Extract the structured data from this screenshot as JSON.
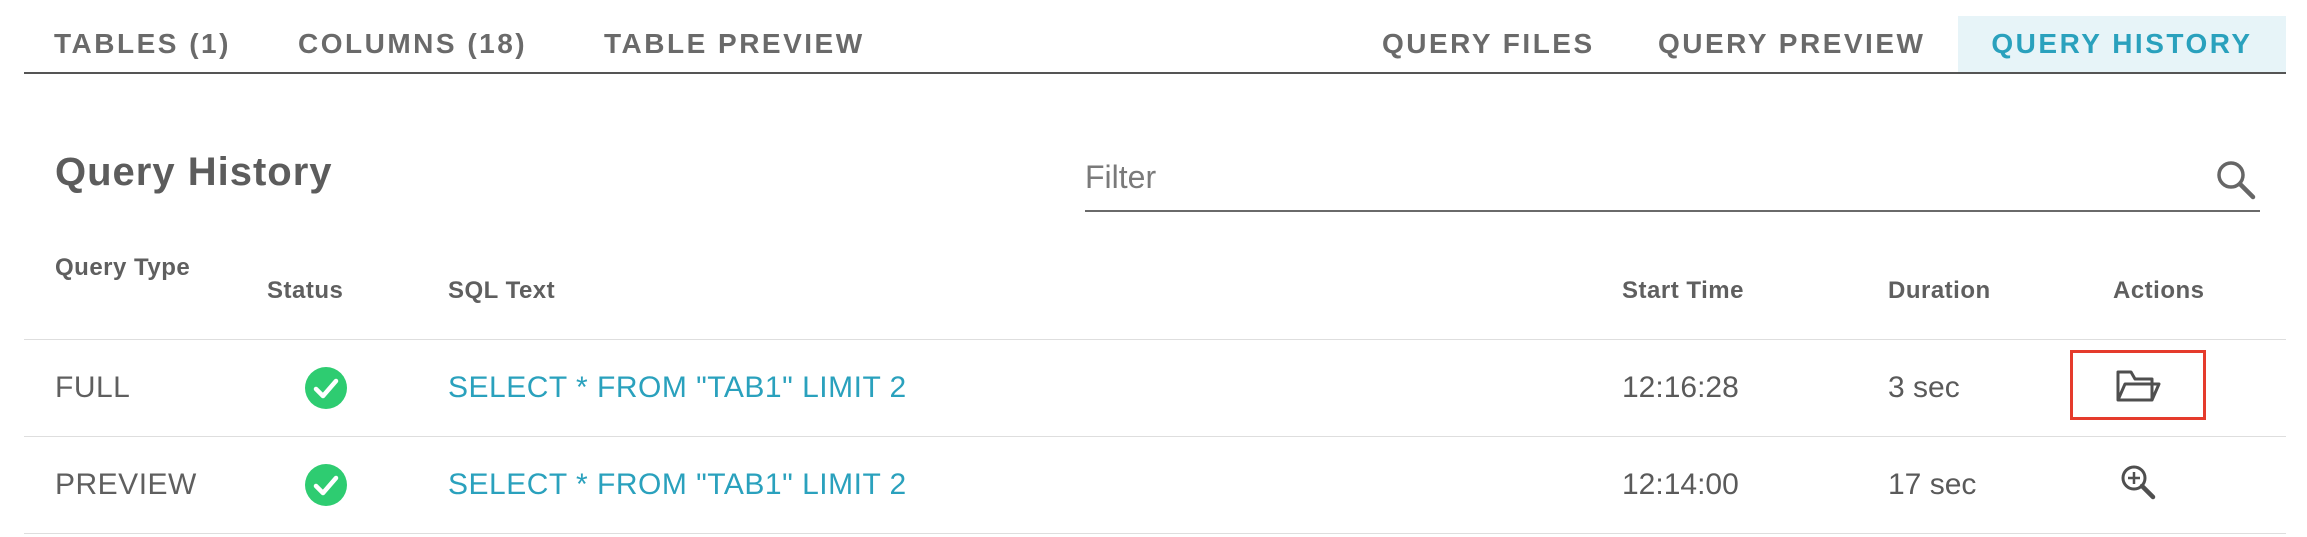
{
  "tabs": {
    "tables": "TABLES (1)",
    "columns": "COLUMNS (18)",
    "table_preview": "TABLE PREVIEW",
    "query_files": "QUERY FILES",
    "query_preview": "QUERY PREVIEW",
    "query_history": "QUERY HISTORY",
    "active": "query_history"
  },
  "page": {
    "title": "Query History"
  },
  "filter": {
    "placeholder": "Filter",
    "value": ""
  },
  "table": {
    "headers": {
      "query_type": "Query Type",
      "status": "Status",
      "sql_text": "SQL Text",
      "start_time": "Start Time",
      "duration": "Duration",
      "actions": "Actions"
    },
    "rows": [
      {
        "query_type": "FULL",
        "status": "success",
        "sql_text": "SELECT * FROM \"TAB1\" LIMIT 2",
        "start_time": "12:16:28",
        "duration": "3 sec",
        "action_icon": "folder-open-icon"
      },
      {
        "query_type": "PREVIEW",
        "status": "success",
        "sql_text": "SELECT * FROM \"TAB1\" LIMIT 2",
        "start_time": "12:14:00",
        "duration": "17 sec",
        "action_icon": "zoom-in-icon"
      }
    ]
  },
  "colors": {
    "accent": "#2aa1bd",
    "active_tab_bg": "#e7f4f8",
    "success": "#2ecc71",
    "highlight_border": "#e53b2c"
  }
}
